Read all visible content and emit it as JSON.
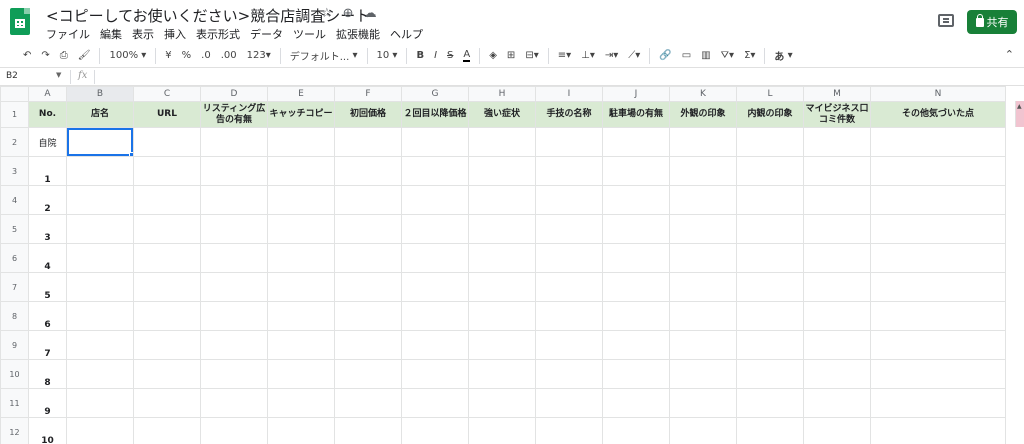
{
  "app": {
    "doc_title": "<コピーしてお使いください>競合店調査シート",
    "share_label": "共有",
    "colors": {
      "brand": "#0f9d58",
      "share_bg": "#188038",
      "header_fill": "#d9ead3",
      "selection": "#1a73e8"
    }
  },
  "menu": [
    "ファイル",
    "編集",
    "表示",
    "挿入",
    "表示形式",
    "データ",
    "ツール",
    "拡張機能",
    "ヘルプ"
  ],
  "toolbar": {
    "zoom": "100%",
    "currency": "¥",
    "percent": "%",
    "dec_less": ".0",
    "dec_more": ".00",
    "format_more": "123",
    "font": "デフォルト...",
    "font_size": "10",
    "bold": "B",
    "italic": "I",
    "strike": "S",
    "text_color": "A",
    "input_tools": "あ"
  },
  "formula": {
    "name_box": "B2",
    "fx": "fx",
    "content": ""
  },
  "sheet": {
    "columns": [
      "A",
      "B",
      "C",
      "D",
      "E",
      "F",
      "G",
      "H",
      "I",
      "J",
      "K",
      "L",
      "M",
      "N"
    ],
    "active_column": "B",
    "headers": [
      "No.",
      "店名",
      "URL",
      "リスティング広告の有無",
      "キャッチコピー",
      "初回価格",
      "２回目以降価格",
      "強い症状",
      "手技の名称",
      "駐車場の有無",
      "外観の印象",
      "内観の印象",
      "マイビジネス口コミ件数",
      "その他気づいた点"
    ],
    "row_labels": [
      "自院",
      "1",
      "2",
      "3",
      "4",
      "5",
      "6",
      "7",
      "8",
      "9",
      "10"
    ],
    "row_numbers": [
      "1",
      "2",
      "3",
      "4",
      "5",
      "6",
      "7",
      "8",
      "9",
      "10",
      "11",
      "12"
    ],
    "selected_cell": "B2"
  }
}
